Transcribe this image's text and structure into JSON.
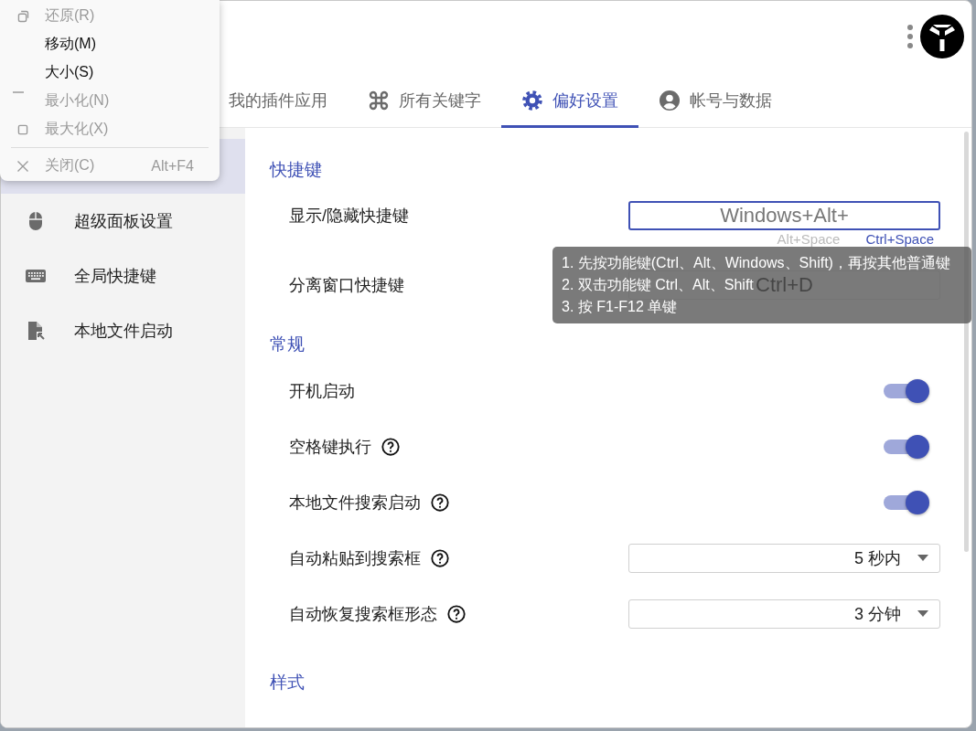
{
  "system_menu": {
    "items": [
      {
        "label": "还原(R)",
        "disabled": true
      },
      {
        "label": "移动(M)",
        "disabled": false
      },
      {
        "label": "大小(S)",
        "disabled": false
      },
      {
        "label": "最小化(N)",
        "disabled": true
      },
      {
        "label": "最大化(X)",
        "disabled": true
      },
      {
        "kind": "separator"
      },
      {
        "label": "关闭(C)",
        "shortcut": "Alt+F4",
        "disabled": true
      }
    ]
  },
  "tabs": [
    {
      "label": "我的插件应用",
      "selected": false
    },
    {
      "label": "所有关键字",
      "selected": false
    },
    {
      "label": "偏好设置",
      "selected": true
    },
    {
      "label": "帐号与数据",
      "selected": false
    }
  ],
  "sidebar": {
    "items": [
      {
        "selected": true
      },
      {
        "label": "超级面板设置",
        "selected": false
      },
      {
        "label": "全局快捷键",
        "selected": false
      },
      {
        "label": "本地文件启动",
        "selected": false
      }
    ]
  },
  "sections": [
    {
      "title": "快捷键",
      "rows": [
        {
          "kind": "shortcut",
          "label": "显示/隐藏快捷键",
          "value": "Windows+Alt+",
          "focused": true,
          "suggestions": [
            {
              "label": "Alt+Space",
              "selected": false
            },
            {
              "label": "Ctrl+Space",
              "selected": true
            }
          ]
        },
        {
          "kind": "shortcut",
          "label": "分离窗口快捷键",
          "value": "Ctrl+D"
        }
      ]
    },
    {
      "title": "常规",
      "rows": [
        {
          "kind": "toggle",
          "label": "开机启动",
          "help": false,
          "on": true
        },
        {
          "kind": "toggle",
          "label": "空格键执行",
          "help": true,
          "on": true
        },
        {
          "kind": "toggle",
          "label": "本地文件搜索启动",
          "help": true,
          "on": true
        },
        {
          "kind": "select",
          "label": "自动粘贴到搜索框",
          "help": true,
          "value": "5 秒内"
        },
        {
          "kind": "select",
          "label": "自动恢复搜索框形态",
          "help": true,
          "value": "3 分钟"
        }
      ]
    },
    {
      "title": "样式"
    }
  ],
  "tooltip": {
    "lines": [
      "1. 先按功能键(Ctrl、Alt、Windows、Shift)，再按其他普通键",
      "2. 双击功能键 Ctrl、Alt、Shift",
      "3. 按 F1-F12 单键"
    ]
  }
}
